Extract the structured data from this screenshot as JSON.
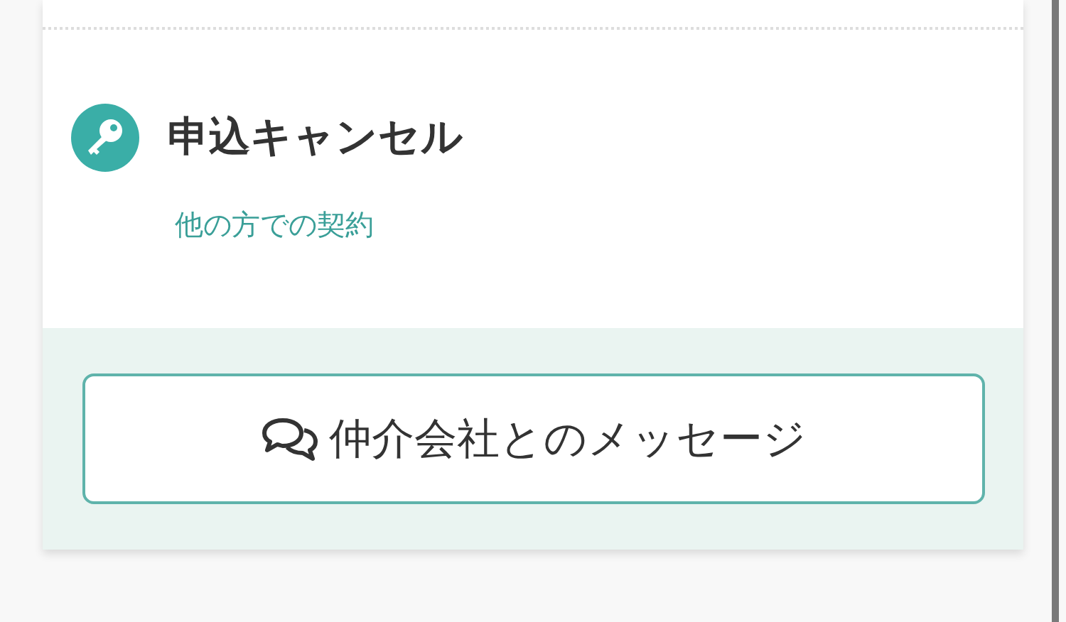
{
  "status": {
    "title": "申込キャンセル",
    "reason": "他の方での契約"
  },
  "message_button": {
    "label": "仲介会社とのメッセージ"
  }
}
